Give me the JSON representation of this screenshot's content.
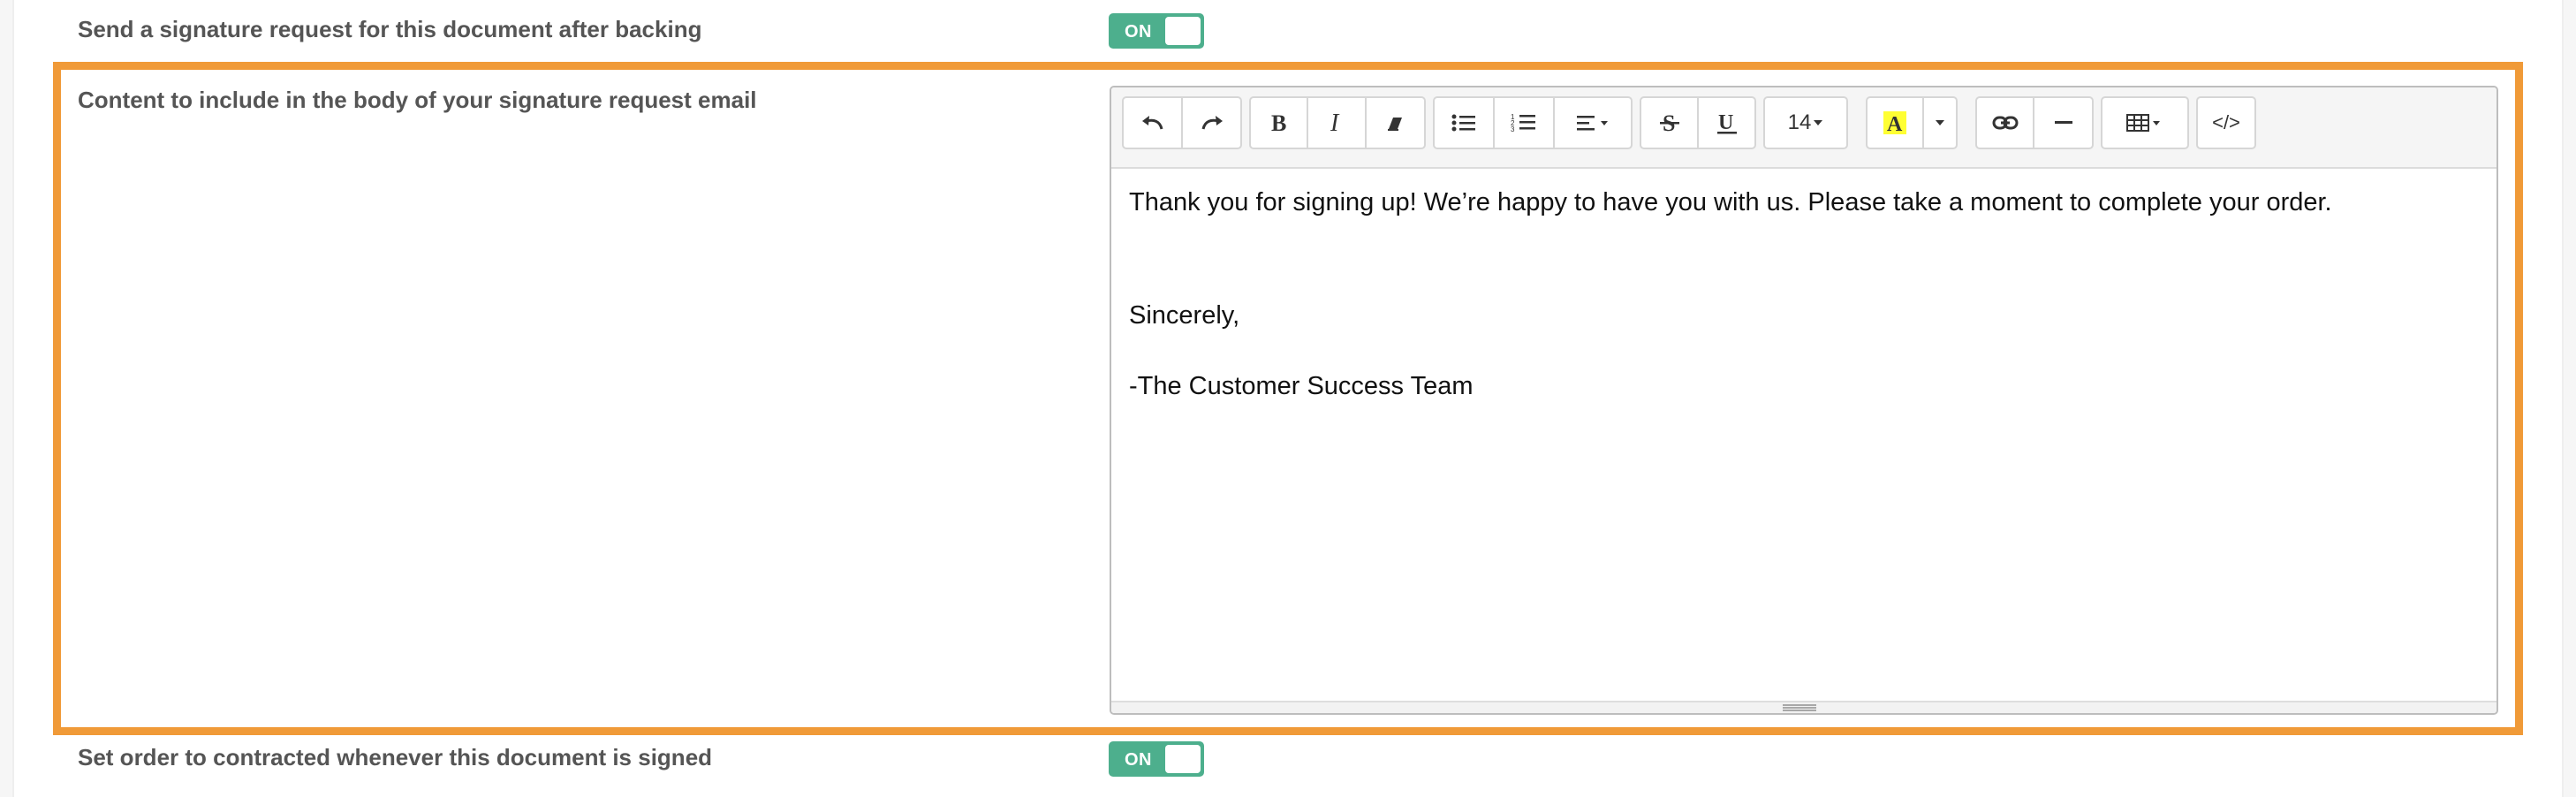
{
  "rows": [
    {
      "label": "Send a signature request for this document after backing",
      "toggle": "ON"
    },
    {
      "label": "Content to include in the body of your signature request email"
    },
    {
      "label": "Set order to contracted whenever this document is signed",
      "toggle": "ON"
    }
  ],
  "toolbar": {
    "font_size": "14",
    "code_view_label": "</>",
    "icons": [
      "undo-icon",
      "redo-icon",
      "bold-icon",
      "italic-icon",
      "eraser-icon",
      "unordered-list-icon",
      "ordered-list-icon",
      "align-icon",
      "strikethrough-icon",
      "underline-icon",
      "font-size-dropdown",
      "highlight-icon",
      "link-icon",
      "horizontal-rule-icon",
      "table-icon",
      "code-view-icon"
    ],
    "highlight_color": "#ffff33"
  },
  "editor": {
    "line1": "Thank you for signing up!  We’re happy to have you with us. Please take a moment to complete your order.",
    "line2": "Sincerely,",
    "line3": "-The Customer Success Team"
  },
  "colors": {
    "accent_highlight": "#f09a38",
    "toggle_on": "#4daf8d"
  }
}
